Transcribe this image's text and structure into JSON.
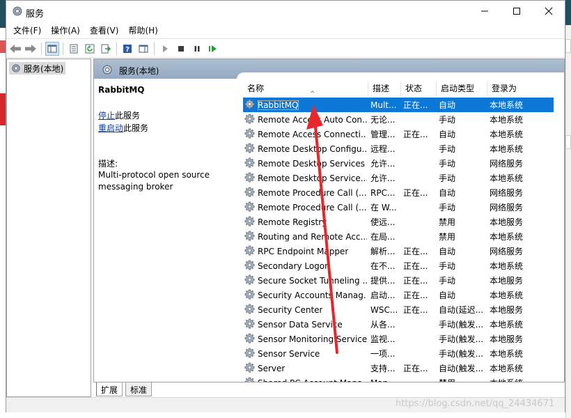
{
  "window": {
    "title": "服务"
  },
  "menu": [
    "文件(F)",
    "操作(A)",
    "查看(V)",
    "帮助(H)"
  ],
  "toolbar_icons": [
    "back-arrow-icon",
    "forward-arrow-icon",
    "console-tree-icon",
    "properties-icon",
    "refresh-icon",
    "export-list-icon",
    "help-icon",
    "show-action-pane-icon",
    "start-service-icon",
    "stop-service-icon",
    "pause-service-icon",
    "restart-service-icon"
  ],
  "tree": {
    "node_label": "服务(本地)"
  },
  "main": {
    "header_title": "服务(本地)",
    "detail": {
      "service_name": "RabbitMQ",
      "stop_link": "停止",
      "stop_suffix": "此服务",
      "restart_link": "重启动",
      "restart_suffix": "此服务",
      "desc_label": "描述:",
      "desc_text": "Multi-protocol open source messaging broker"
    },
    "columns": [
      "名称",
      "描述",
      "状态",
      "启动类型",
      "登录为"
    ],
    "rows": [
      {
        "name": "RabbitMQ",
        "desc": "Mult...",
        "status": "正在...",
        "start": "自动",
        "logon": "本地系统",
        "selected": true
      },
      {
        "name": "Remote Access Auto Con...",
        "desc": "无论...",
        "status": "",
        "start": "手动",
        "logon": "本地系统"
      },
      {
        "name": "Remote Access Connecti...",
        "desc": "管理...",
        "status": "正在...",
        "start": "自动",
        "logon": "本地系统"
      },
      {
        "name": "Remote Desktop Configu...",
        "desc": "远程...",
        "status": "",
        "start": "手动",
        "logon": "本地系统"
      },
      {
        "name": "Remote Desktop Services",
        "desc": "允许...",
        "status": "",
        "start": "手动",
        "logon": "网络服务"
      },
      {
        "name": "Remote Desktop Service...",
        "desc": "允许...",
        "status": "",
        "start": "手动",
        "logon": "本地系统"
      },
      {
        "name": "Remote Procedure Call (...",
        "desc": "RPC...",
        "status": "正在...",
        "start": "自动",
        "logon": "网络服务"
      },
      {
        "name": "Remote Procedure Call (...",
        "desc": "在 W...",
        "status": "",
        "start": "手动",
        "logon": "网络服务"
      },
      {
        "name": "Remote Registry",
        "desc": "使远...",
        "status": "",
        "start": "禁用",
        "logon": "本地服务"
      },
      {
        "name": "Routing and Remote Acc...",
        "desc": "在局...",
        "status": "",
        "start": "禁用",
        "logon": "本地系统"
      },
      {
        "name": "RPC Endpoint Mapper",
        "desc": "解析...",
        "status": "正在...",
        "start": "自动",
        "logon": "网络服务"
      },
      {
        "name": "Secondary Logon",
        "desc": "在不...",
        "status": "正在...",
        "start": "手动",
        "logon": "本地系统"
      },
      {
        "name": "Secure Socket Tunneling ...",
        "desc": "提供...",
        "status": "正在...",
        "start": "手动",
        "logon": "本地服务"
      },
      {
        "name": "Security Accounts Manag...",
        "desc": "启动...",
        "status": "正在...",
        "start": "自动",
        "logon": "本地系统"
      },
      {
        "name": "Security Center",
        "desc": "WSC...",
        "status": "正在...",
        "start": "自动(延迟...",
        "logon": "本地服务"
      },
      {
        "name": "Sensor Data Service",
        "desc": "从各...",
        "status": "",
        "start": "手动(触发...",
        "logon": "本地系统"
      },
      {
        "name": "Sensor Monitoring Service",
        "desc": "监视...",
        "status": "",
        "start": "手动(触发...",
        "logon": "本地服务"
      },
      {
        "name": "Sensor Service",
        "desc": "一项...",
        "status": "",
        "start": "手动(触发...",
        "logon": "本地系统"
      },
      {
        "name": "Server",
        "desc": "支持...",
        "status": "正在...",
        "start": "自动(触发...",
        "logon": "本地系统"
      },
      {
        "name": "Shared PC Account Mana...",
        "desc": "Man...",
        "status": "",
        "start": "禁用",
        "logon": "本地系统"
      }
    ]
  },
  "tabs": [
    "扩展",
    "标准"
  ],
  "watermark": "https://blog.csdn.net/qq_24434671",
  "colors": {
    "selection": "#0b78d7",
    "header": "#95aac2",
    "annotation_arrow": "#e8262b",
    "link": "#0b3fa8"
  }
}
